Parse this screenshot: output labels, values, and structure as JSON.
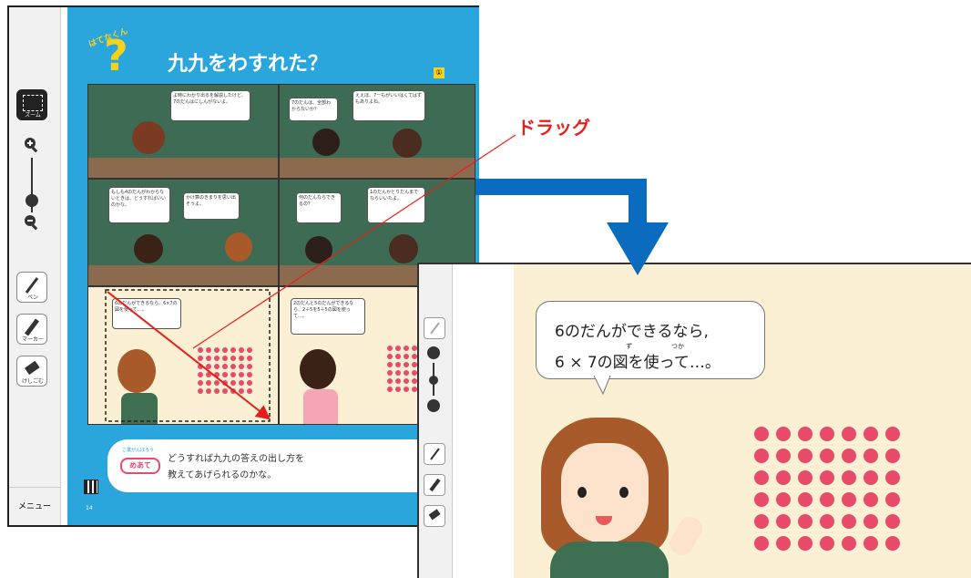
{
  "annotation": {
    "drag_label": "ドラッグ",
    "colors": {
      "drag_text": "#e3211c",
      "arrow": "#0a6bbf",
      "line": "#e3211c"
    }
  },
  "toolbar": {
    "zoom_button_label": "ズーム",
    "pen_label": "ペン",
    "marker_label": "マーカー",
    "eraser_label": "けしごむ",
    "menu_label": "メニュー"
  },
  "page": {
    "header_badge": "はてなくん",
    "title": "九九をわすれた？",
    "corner_badge": "①",
    "page_number": "14",
    "bubbles": [
      "よ時にわかり出るを解説したけど、7のだんはにしんがないよ。",
      "7のだんは、全部わからないか？",
      "ええほ、7ーもがいいはくてはずもありよね。",
      "もしも4のだんがわからないときは、どうすればいいのかな。",
      "かけ算のきまりを思い出そうよ。",
      "何のだんならできるの？",
      "1のだんかとりだんまでならいいたよ。",
      "6のだんができるなら、6×7の図を使って…。",
      "2のだんと5のだんができるなら、2＋5を5＋5の図を使って…。"
    ],
    "goal_tag": "めあて",
    "goal_sub": "こ業がんばろう",
    "goal_text_1": "どうすれば九九の答えの出し方を",
    "goal_text_2": "教えてあげられるのかな。"
  },
  "zoom_view": {
    "bubble_line1": "6のだんができるなら,",
    "bubble_line2": "6 × 7の図を使って…。",
    "ruby_zu": "ず",
    "ruby_tsuka": "つか",
    "dot_color": "#e84a6a"
  }
}
